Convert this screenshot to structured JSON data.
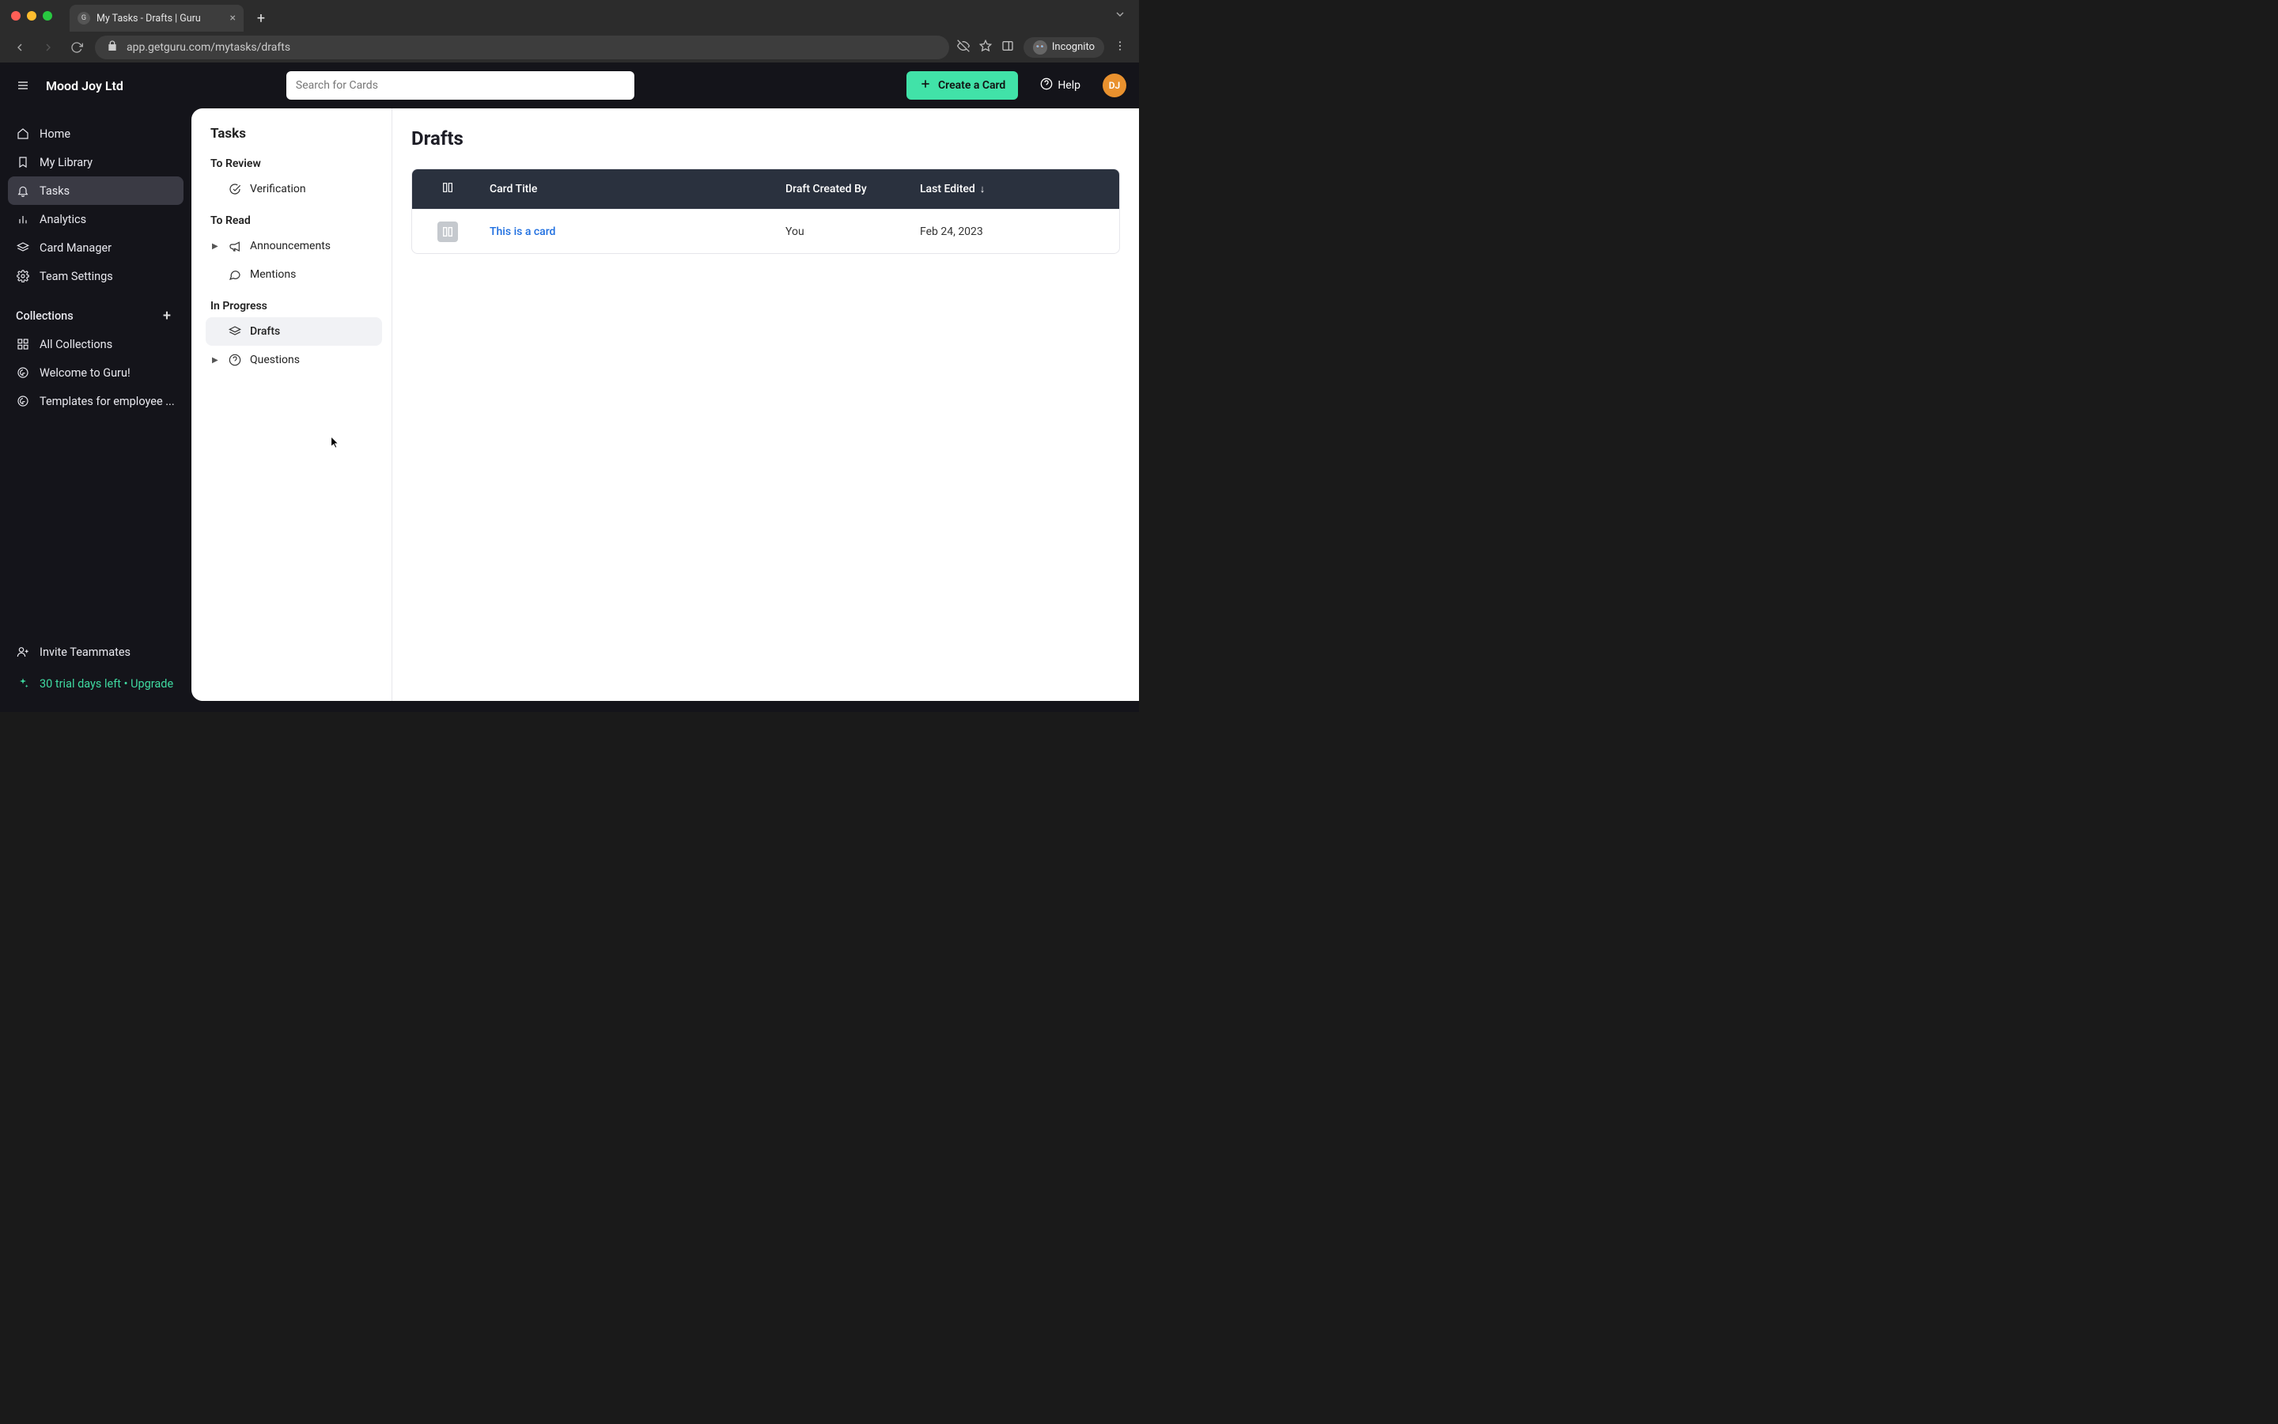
{
  "browser": {
    "tab_title": "My Tasks - Drafts | Guru",
    "url": "app.getguru.com/mytasks/drafts",
    "incognito_label": "Incognito"
  },
  "header": {
    "workspace": "Mood Joy Ltd",
    "search_placeholder": "Search for Cards",
    "create_card_label": "Create a Card",
    "help_label": "Help",
    "avatar_initials": "DJ"
  },
  "leftnav": {
    "items": [
      {
        "label": "Home",
        "icon": "home-icon"
      },
      {
        "label": "My Library",
        "icon": "bookmark-icon"
      },
      {
        "label": "Tasks",
        "icon": "bell-icon",
        "active": true
      },
      {
        "label": "Analytics",
        "icon": "bars-icon"
      },
      {
        "label": "Card Manager",
        "icon": "stack-icon"
      },
      {
        "label": "Team Settings",
        "icon": "gear-icon"
      }
    ],
    "collections_label": "Collections",
    "collections": [
      {
        "label": "All Collections",
        "icon": "grid-icon"
      },
      {
        "label": "Welcome to Guru!",
        "icon": "guru-icon"
      },
      {
        "label": "Templates for employee ...",
        "icon": "guru-icon"
      }
    ],
    "invite_label": "Invite Teammates",
    "trial_label": "30 trial days left • Upgrade"
  },
  "tasks_panel": {
    "title": "Tasks",
    "groups": {
      "to_review": {
        "label": "To Review",
        "items": [
          {
            "label": "Verification",
            "icon": "check-circle-icon"
          }
        ]
      },
      "to_read": {
        "label": "To Read",
        "items": [
          {
            "label": "Announcements",
            "icon": "megaphone-icon",
            "expandable": true
          },
          {
            "label": "Mentions",
            "icon": "chat-icon"
          }
        ]
      },
      "in_progress": {
        "label": "In Progress",
        "items": [
          {
            "label": "Drafts",
            "icon": "stack-icon",
            "active": true
          },
          {
            "label": "Questions",
            "icon": "question-icon",
            "expandable": true
          }
        ]
      }
    }
  },
  "main": {
    "title": "Drafts",
    "columns": {
      "icon": "",
      "card_title": "Card Title",
      "created_by": "Draft Created By",
      "last_edited": "Last Edited"
    },
    "sort": {
      "column": "last_edited",
      "direction": "desc"
    },
    "rows": [
      {
        "card_title": "This is a card",
        "created_by": "You",
        "last_edited": "Feb 24, 2023"
      }
    ]
  }
}
